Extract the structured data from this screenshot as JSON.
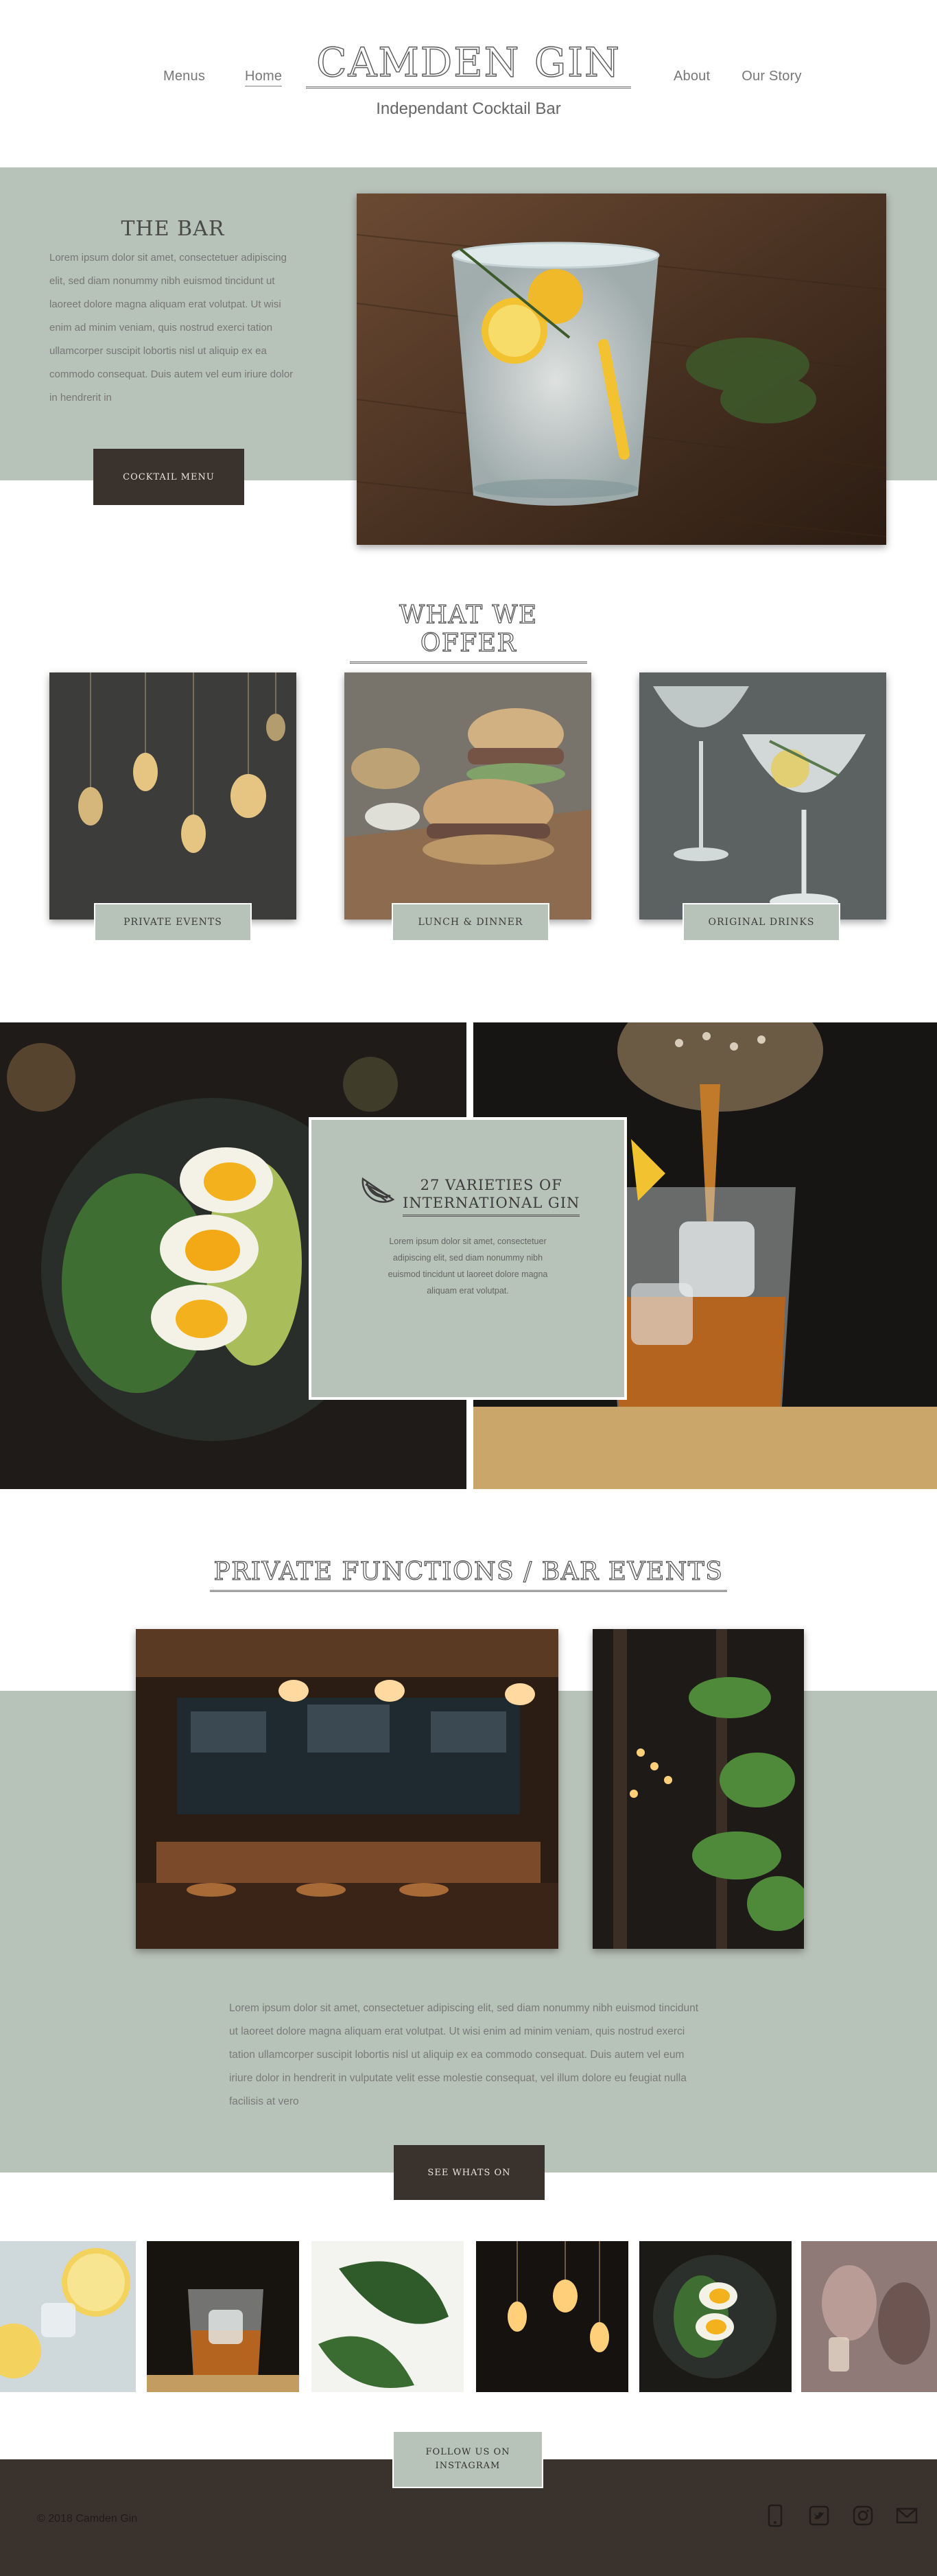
{
  "header": {
    "brand": "CAMDEN GIN",
    "tagline": "Independant Cocktail Bar",
    "nav_left": [
      "Menus",
      "Home"
    ],
    "nav_right": [
      "About",
      "Our Story"
    ],
    "active": "Home"
  },
  "bar": {
    "title": "THE BAR",
    "paragraph": "Lorem ipsum dolor sit amet, consectetuer adipiscing elit, sed diam nonummy nibh euismod tincidunt ut laoreet dolore magna aliquam erat volutpat. Ut wisi enim ad minim veniam, quis nostrud exerci tation ullamcorper suscipit lobortis nisl ut aliquip ex ea commodo consequat. Duis autem vel eum iriure dolor in hendrerit in",
    "button": "COCKTAIL MENU"
  },
  "offer": {
    "title": "WHAT WE OFFER",
    "items": [
      "PRIVATE EVENTS",
      "LUNCH & DINNER",
      "ORIGINAL DRINKS"
    ]
  },
  "varieties": {
    "title_line1": "27 VARIETIES OF",
    "title_line2": "INTERNATIONAL GIN",
    "text": "Lorem ipsum dolor sit amet, consectetuer adipiscing elit, sed diam nonummy nibh euismod tincidunt ut laoreet dolore magna aliquam erat volutpat."
  },
  "functions": {
    "title": "PRIVATE FUNCTIONS / BAR EVENTS",
    "paragraph": "Lorem ipsum dolor sit amet, consectetuer adipiscing elit, sed diam nonummy nibh euismod tincidunt ut laoreet dolore magna aliquam erat volutpat. Ut wisi enim ad minim veniam, quis nostrud exerci tation ullamcorper suscipit lobortis nisl ut aliquip ex ea commodo consequat. Duis autem vel eum iriure dolor in hendrerit in vulputate velit esse molestie consequat, vel illum dolore eu feugiat nulla facilisis at vero",
    "button": "SEE WHATS ON"
  },
  "footer": {
    "follow_line1": "FOLLOW US ON",
    "follow_line2": "INSTAGRAM",
    "copyright": "© 2018 Camden Gin",
    "social_icons": [
      "phone-icon",
      "twitter-icon",
      "instagram-icon",
      "email-icon"
    ]
  },
  "colors": {
    "sage": "#b7c2b8",
    "brown": "#3a332d"
  }
}
